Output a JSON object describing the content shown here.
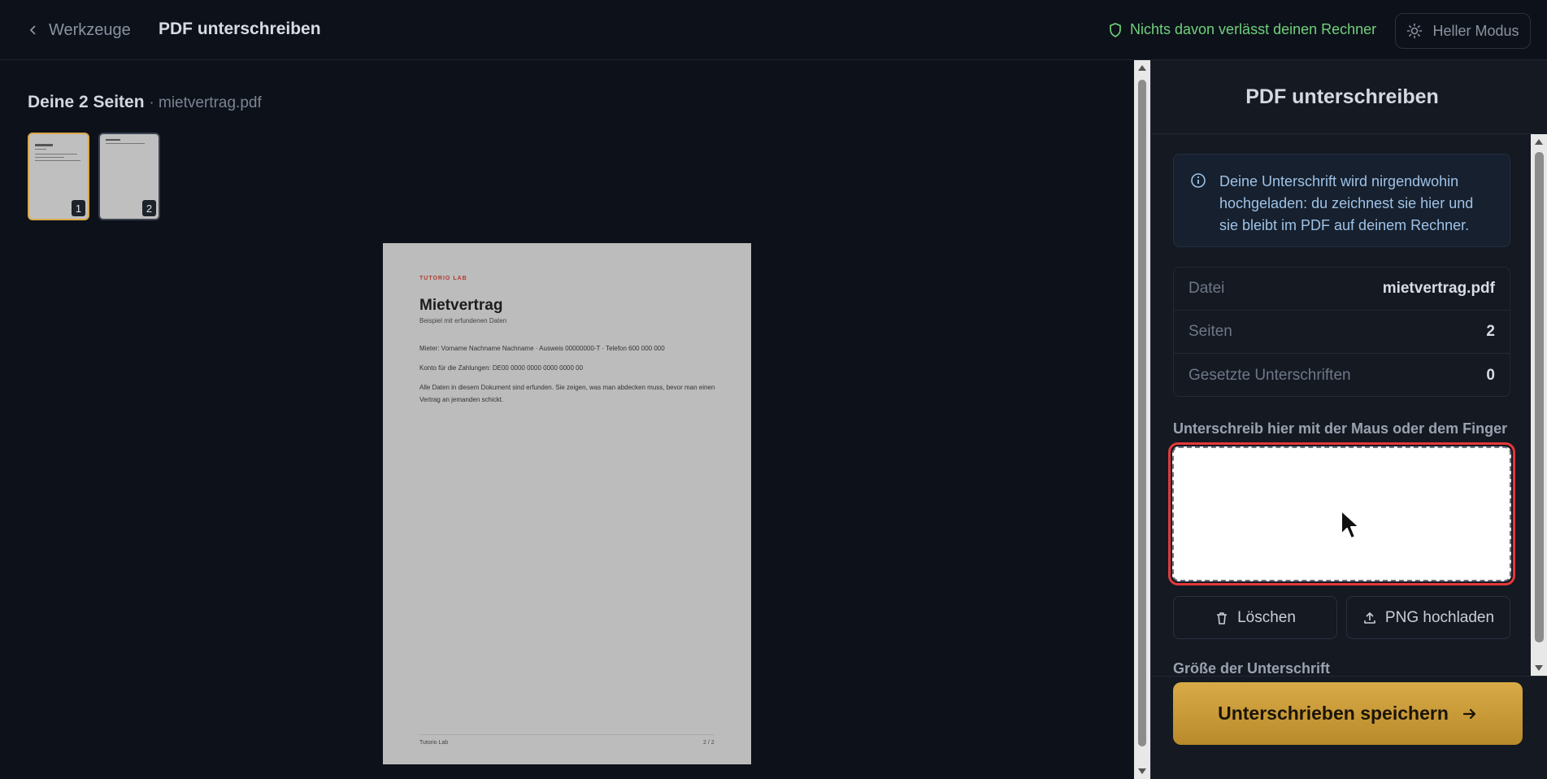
{
  "header": {
    "back_label": "Werkzeuge",
    "title": "PDF unterschreiben",
    "privacy_note": "Nichts davon verlässt deinen Rechner",
    "mode_toggle_label": "Heller Modus"
  },
  "preview": {
    "pages_title": "Deine 2 Seiten",
    "file_suffix": "· mietvertrag.pdf",
    "thumbnails": [
      {
        "number": "1",
        "selected": true
      },
      {
        "number": "2",
        "selected": false
      }
    ],
    "document": {
      "brand": "TUTORIO LAB",
      "title": "Mietvertrag",
      "subtitle": "Beispiel mit erfundenen Daten",
      "line1": "Mieter: Vorname Nachname Nachname · Ausweis 00000000-T · Telefon 600 000 000",
      "line2": "Konto für die Zahlungen: DE00 0000 0000 0000 0000 00",
      "line3": "Alle Daten in diesem Dokument sind erfunden. Sie zeigen, was man abdecken muss, bevor man einen Vertrag an jemanden schickt.",
      "footer_left": "Tutorio Lab",
      "footer_right": "2 / 2"
    }
  },
  "panel": {
    "title": "PDF unterschreiben",
    "info_text": "Deine Unterschrift wird nirgendwohin hochgeladen: du zeichnest sie hier und sie bleibt im PDF auf deinem Rechner.",
    "stats": [
      {
        "key": "Datei",
        "value": "mietvertrag.pdf"
      },
      {
        "key": "Seiten",
        "value": "2"
      },
      {
        "key": "Gesetzte Unterschriften",
        "value": "0"
      }
    ],
    "signature_label": "Unterschreib hier mit der Maus oder dem Finger",
    "clear_button": "Löschen",
    "upload_button": "PNG hochladen",
    "size_label": "Größe der Unterschrift",
    "save_button": "Unterschrieben speichern"
  },
  "colors": {
    "accent": "#d7a84a",
    "privacy_green": "#6fd17d",
    "focus_red": "#e5383b",
    "info_blue": "#9fc2e6"
  },
  "icons": [
    "chevron-left-icon",
    "shield-icon",
    "sun-icon",
    "info-icon",
    "trash-icon",
    "upload-icon",
    "arrow-right-icon",
    "mouse-cursor-icon"
  ]
}
